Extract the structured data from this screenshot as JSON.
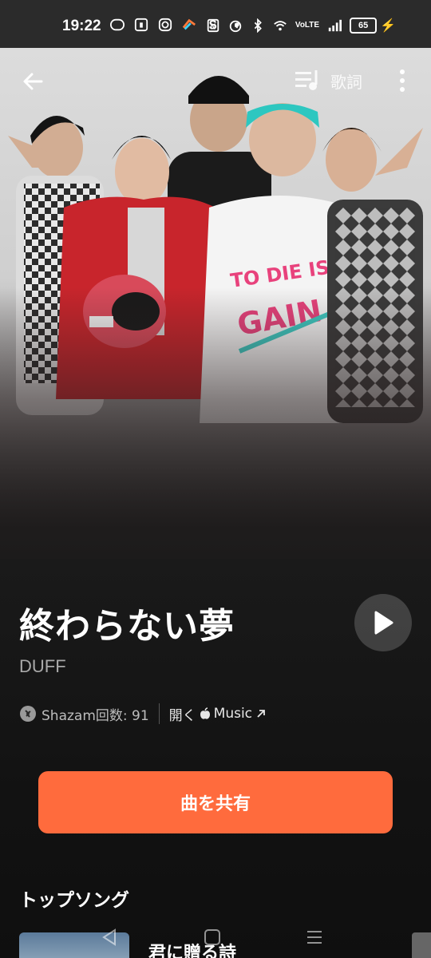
{
  "status_bar": {
    "time": "19:22",
    "battery": "65",
    "network": "VoLTE"
  },
  "top_bar": {
    "lyrics_label": "歌詞"
  },
  "song": {
    "title": "終わらない夢",
    "artist": "DUFF",
    "shazam_count": "Shazam回数: 91",
    "open_label": "開く",
    "music_service": "Music"
  },
  "actions": {
    "share_label": "曲を共有"
  },
  "top_songs": {
    "section_title": "トップソング",
    "items": [
      {
        "title": "君に贈る詩"
      }
    ]
  },
  "hero": {
    "shirt_text": "TO DIE IS GAIN"
  },
  "colors": {
    "accent": "#ff6b3d",
    "background": "#121212",
    "status_bar": "#2b2b2b"
  },
  "icons": {
    "back": "arrow-left-icon",
    "lyrics": "lyrics-icon",
    "more": "more-vertical-icon",
    "play": "play-icon",
    "shazam": "shazam-icon",
    "external": "external-link-icon"
  }
}
